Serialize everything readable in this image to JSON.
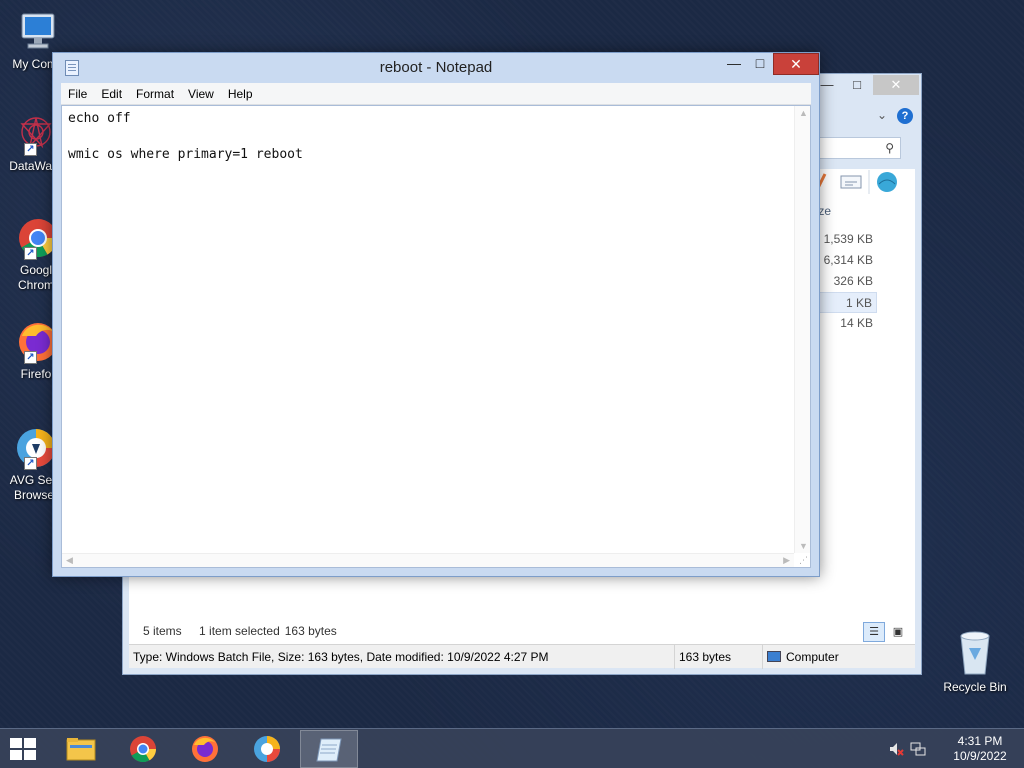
{
  "desktop": {
    "icons": [
      {
        "label": "My Comp",
        "icon": "computer-icon"
      },
      {
        "label": "DataWag",
        "icon": "datawagon-icon"
      },
      {
        "label": "Googl\nChrom",
        "icon": "chrome-icon"
      },
      {
        "label": "Firefo",
        "icon": "firefox-icon"
      },
      {
        "label": "AVG Sec\nBrowse",
        "icon": "avg-browser-icon"
      }
    ],
    "recycle_bin": "Recycle Bin"
  },
  "explorer": {
    "column_header": "ze",
    "sizes": [
      "1,539 KB",
      "6,314 KB",
      "326 KB",
      "1 KB",
      "14 KB"
    ],
    "selected_index": 3,
    "items_count": "5 items",
    "selection_info": "1 item selected",
    "selection_size": "163 bytes",
    "status_details": "Type: Windows Batch File, Size: 163 bytes, Date modified: 10/9/2022 4:27 PM",
    "status_size": "163 bytes",
    "status_location": "Computer"
  },
  "notepad": {
    "title": "reboot - Notepad",
    "menu": [
      "File",
      "Edit",
      "Format",
      "View",
      "Help"
    ],
    "content": "echo off\n\nwmic os where primary=1 reboot"
  },
  "taskbar": {
    "apps": [
      {
        "name": "file-explorer",
        "active": false
      },
      {
        "name": "chrome",
        "active": false
      },
      {
        "name": "firefox",
        "active": false
      },
      {
        "name": "avg-browser",
        "active": false
      },
      {
        "name": "notepad",
        "active": true
      }
    ],
    "time": "4:31 PM",
    "date": "10/9/2022"
  }
}
